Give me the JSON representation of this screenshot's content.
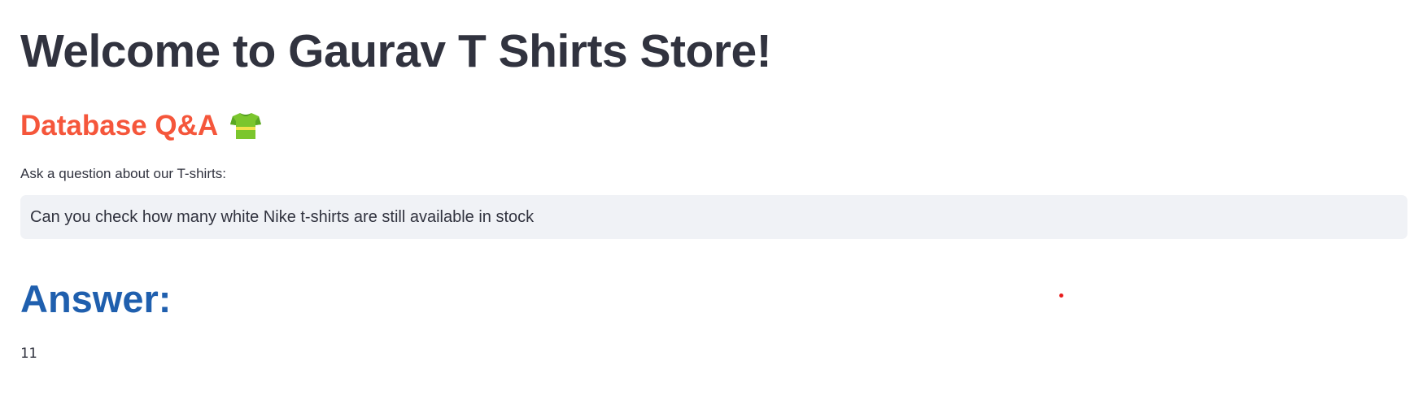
{
  "page": {
    "title": "Welcome to Gaurav T Shirts Store!",
    "subtitle": "Database Q&A",
    "subtitle_icon": "tshirt-icon",
    "accent_color": "#f5563b",
    "answer_color": "#1f5fae"
  },
  "question": {
    "label": "Ask a question about our T-shirts:",
    "value": "Can you check how many white Nike t-shirts are still available in stock"
  },
  "answer": {
    "heading": "Answer:",
    "value": "11"
  }
}
